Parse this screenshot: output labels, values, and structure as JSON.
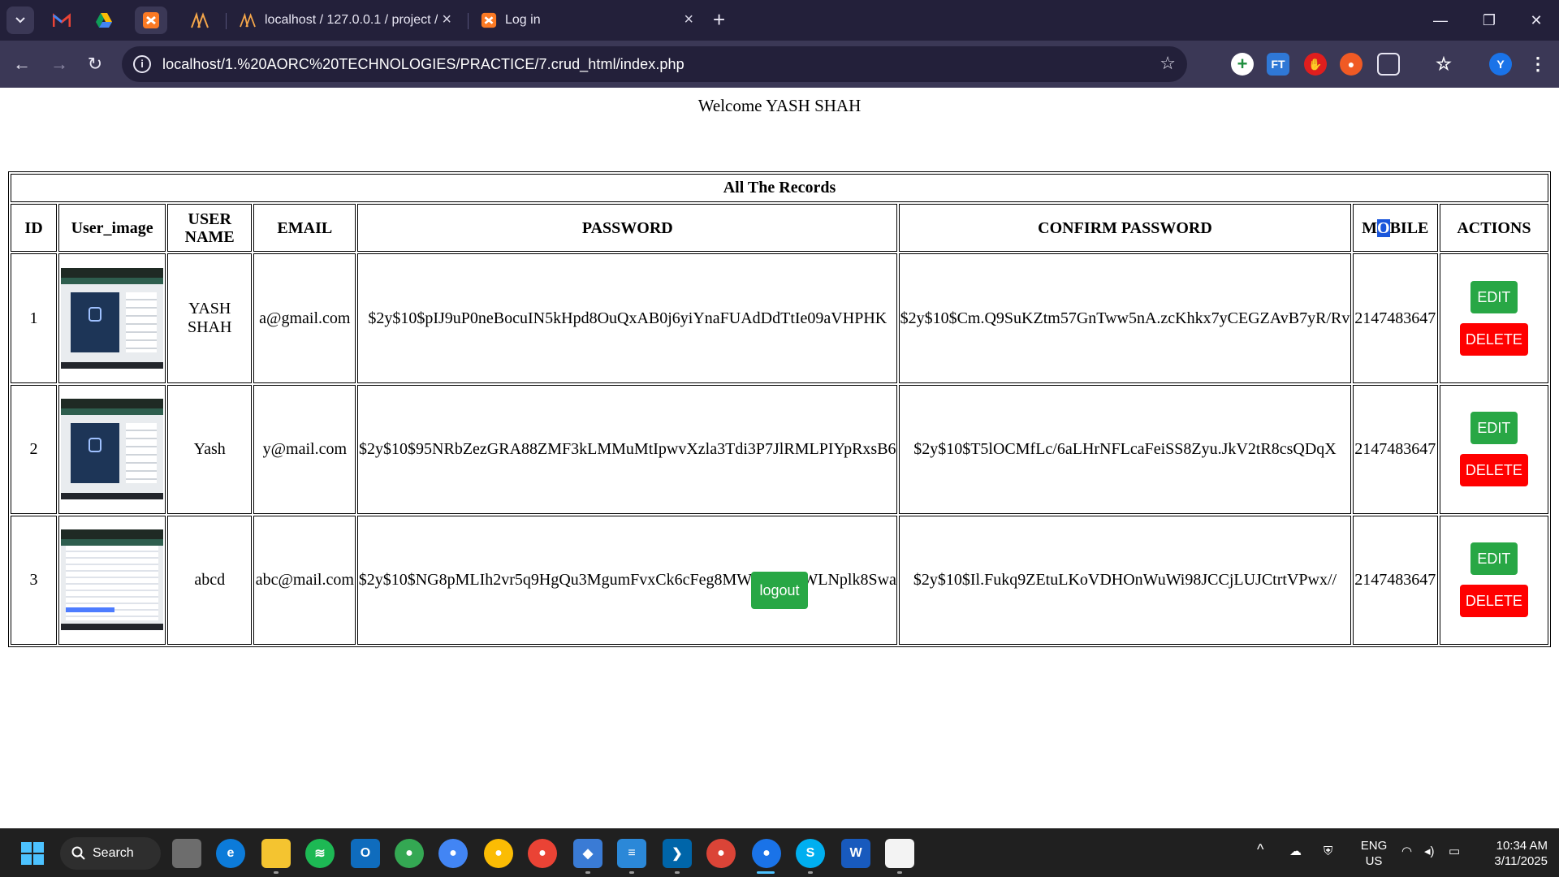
{
  "browser": {
    "tabs": [
      {
        "title": "localhost / 127.0.0.1 / project /"
      },
      {
        "title": "Log in"
      }
    ],
    "new_tab": "+",
    "url": "localhost/1.%20AORC%20TECHNOLOGIES/PRACTICE/7.crud_html/index.php",
    "profile_initial": "Y"
  },
  "page": {
    "welcome": "Welcome YASH SHAH",
    "table_caption": "All The Records",
    "headers": {
      "id": "ID",
      "image": "User_image",
      "username_line1": "USER",
      "username_line2": "NAME",
      "email": "EMAIL",
      "password": "PASSWORD",
      "confirm": "CONFIRM PASSWORD",
      "mobile_pre": "M",
      "mobile_sel": "O",
      "mobile_post": "BILE",
      "actions": "ACTIONS"
    },
    "rows": [
      {
        "id": "1",
        "username_line1": "YASH",
        "username_line2": "SHAH",
        "email": "a@gmail.com",
        "password": "$2y$10$pIJ9uP0neBocuIN5kHpd8OuQxAB0j6yiYnaFUAdDdTtIe09aVHPHK",
        "confirm": "$2y$10$Cm.Q9SuKZtm57GnTww5nA.zcKhkx7yCEGZAvB7yR/Rv",
        "mobile": "2147483647"
      },
      {
        "id": "2",
        "username_line1": "Yash",
        "username_line2": "",
        "email": "y@mail.com",
        "password": "$2y$10$95NRbZezGRA88ZMF3kLMMuMtIpwvXzla3Tdi3P7JlRMLPIYpRxsB6",
        "confirm": "$2y$10$T5lOCMfLc/6aLHrNFLcaFeiSS8Zyu.JkV2tR8csQDqX",
        "mobile": "2147483647"
      },
      {
        "id": "3",
        "username_line1": "abcd",
        "username_line2": "",
        "email": "abc@mail.com",
        "password": "$2y$10$NG8pMLIh2vr5q9HgQu3MgumFvxCk6cFeg8MWGjFut/2WLNplk8Swa",
        "confirm": "$2y$10$Il.Fukq9ZEtuLKoVDHOnWuWi98JCCjLUJCtrtVPwx//",
        "mobile": "2147483647"
      }
    ],
    "edit_label": "EDIT",
    "delete_label": "DELETE",
    "logout_label": "logout"
  },
  "taskbar": {
    "search_label": "Search",
    "lang_line1": "ENG",
    "lang_line2": "US",
    "time": "10:34 AM",
    "date": "3/11/2025"
  },
  "colors": {
    "edit": "#28a745",
    "delete": "#ff0000",
    "chrome_dark": "#23203a",
    "chrome_toolbar": "#3b3856"
  }
}
